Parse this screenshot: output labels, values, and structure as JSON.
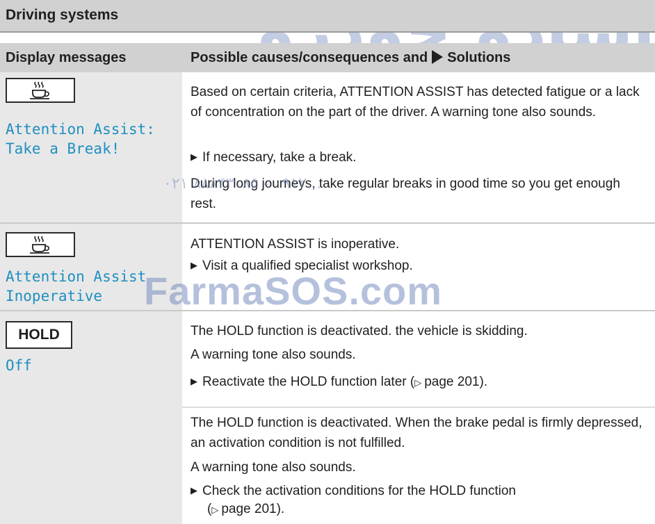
{
  "section_title": "Driving systems",
  "header": {
    "col1": "Display messages",
    "col2_pre": "Possible causes/consequences and",
    "col2_post": "Solutions"
  },
  "watermark": {
    "top": "اسادو خودرو فارا",
    "phone": "۰۲۱ ۸۸۸۴۳۰۸۵ - ۰۹۱۲...",
    "brand": "FarmaSOS.com"
  },
  "rows": [
    {
      "icon": "coffee-cup-icon",
      "message": "Attention Assist:\nTake a Break!",
      "cause": "Based on certain criteria, ATTENTION ASSIST has detected fatigue or a lack of concentration on the part of the driver. A warning tone also sounds.",
      "action": "If necessary, take a break.",
      "note": "During long journeys, take regular breaks in good time so you get enough rest."
    },
    {
      "icon": "coffee-cup-icon",
      "message": "Attention Assist\nInoperative",
      "cause": "ATTENTION ASSIST is inoperative.",
      "action": "Visit a qualified specialist workshop."
    },
    {
      "box_label": "HOLD",
      "message": "Off",
      "case1_cause": "The HOLD function is deactivated. the vehicle is skidding.",
      "case1_tone": "A warning tone also sounds.",
      "case1_action": "Reactivate the HOLD function later (",
      "case1_ref": "page 201).",
      "case2_cause": "The HOLD function is deactivated. When the brake pedal is firmly depressed, an activation condition is not fulfilled.",
      "case2_tone": "A warning tone also sounds.",
      "case2_action": "Check the activation conditions for the HOLD function",
      "case2_ref": "page 201)."
    }
  ]
}
